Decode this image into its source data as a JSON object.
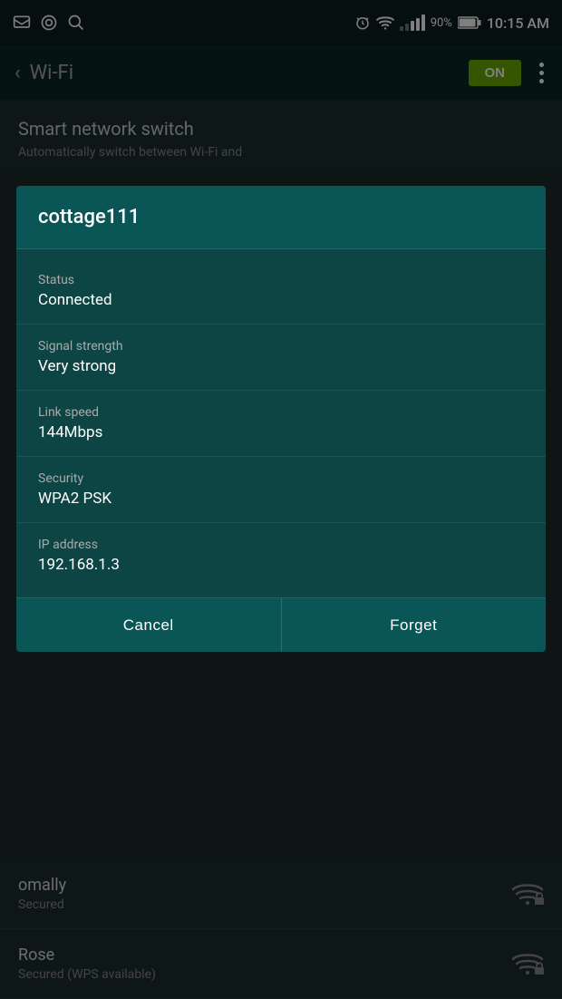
{
  "statusBar": {
    "time": "10:15 AM",
    "battery": "90%"
  },
  "appBar": {
    "backLabel": "‹",
    "title": "Wi-Fi",
    "toggleLabel": "ON"
  },
  "backgroundContent": {
    "smartTitle": "Smart network switch",
    "smartSubtitle": "Automatically switch between Wi-Fi and"
  },
  "dialog": {
    "networkName": "cottage111",
    "statusLabel": "Status",
    "statusValue": "Connected",
    "signalLabel": "Signal strength",
    "signalValue": "Very strong",
    "linkSpeedLabel": "Link speed",
    "linkSpeedValue": "144Mbps",
    "securityLabel": "Security",
    "securityValue": "WPA2 PSK",
    "ipLabel": "IP address",
    "ipValue": "192.168.1.3",
    "cancelLabel": "Cancel",
    "forgetLabel": "Forget"
  },
  "bottomList": [
    {
      "name": "omally",
      "sub": "Secured"
    },
    {
      "name": "Rose",
      "sub": "Secured (WPS available)"
    }
  ]
}
